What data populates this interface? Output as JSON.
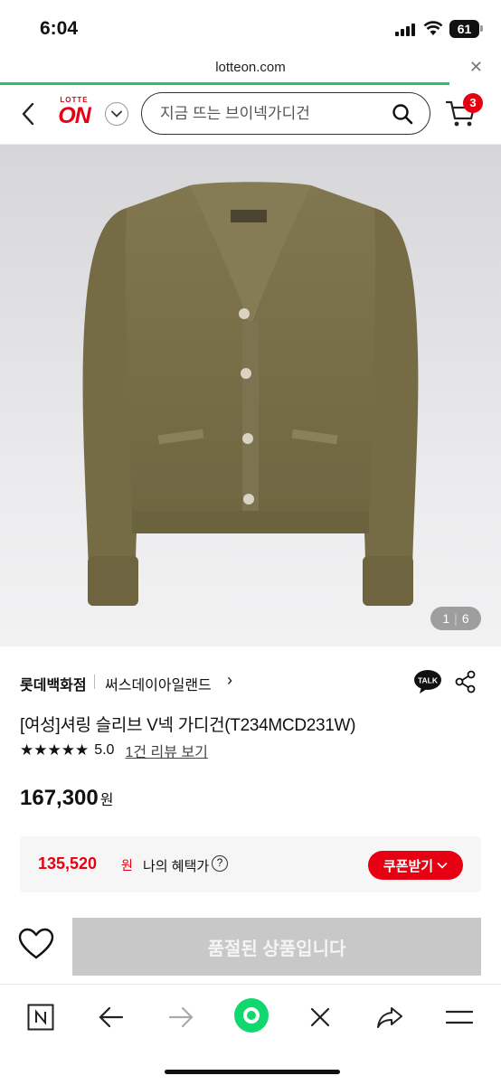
{
  "status_bar": {
    "time": "6:04",
    "battery": "61"
  },
  "browser": {
    "url": "lotteon.com",
    "close_icon": "close-icon"
  },
  "header": {
    "logo_top": "LOTTE",
    "logo_main": "ON",
    "search_placeholder": "지금 뜨는 브이넥가디건",
    "cart_count": "3"
  },
  "gallery": {
    "current": "1",
    "separator": "|",
    "total": "6"
  },
  "product": {
    "store": "롯데백화점",
    "brand": "써스데이아일랜드",
    "brand_chevron": "›",
    "talk_label": "TALK",
    "title": "[여성]셔링 슬리브 V넥 가디건(T234MCD231W)",
    "stars": "★★★★★",
    "score": "5.0",
    "review_link": "1건 리뷰 보기",
    "price": "167,300",
    "price_unit": "원",
    "benefit_price": "135,520",
    "benefit_unit": "원",
    "benefit_label": "나의 혜택가",
    "coupon_label": "쿠폰받기",
    "soldout_label": "품절된 상품입니다"
  },
  "colors": {
    "accent": "#e60012",
    "progress": "#22c55e",
    "soldout_bg": "#c8c8c8",
    "garment": "#7a7048"
  },
  "toolbar": [
    "n-icon",
    "back-arrow-icon",
    "forward-arrow-icon",
    "home-dot-icon",
    "close-icon",
    "share-arrow-icon",
    "menu-icon"
  ]
}
